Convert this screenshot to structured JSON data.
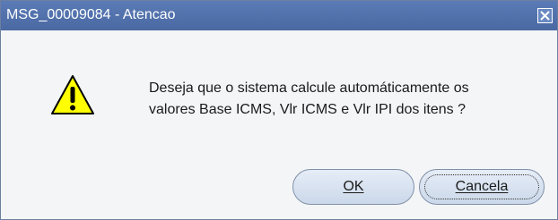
{
  "window": {
    "title": "MSG_00009084 - Atencao",
    "close_icon": "close-icon"
  },
  "message": {
    "icon": "warning-icon",
    "line1": "Deseja que o sistema calcule automáticamente os",
    "line2": "valores Base ICMS, Vlr ICMS e Vlr IPI dos itens ?"
  },
  "buttons": {
    "ok_label": "OK",
    "cancel_label": "Cancela"
  },
  "colors": {
    "titlebar": "#4a69a3",
    "warning_fill": "#ffff00",
    "button_face": "#cbd8ea"
  }
}
